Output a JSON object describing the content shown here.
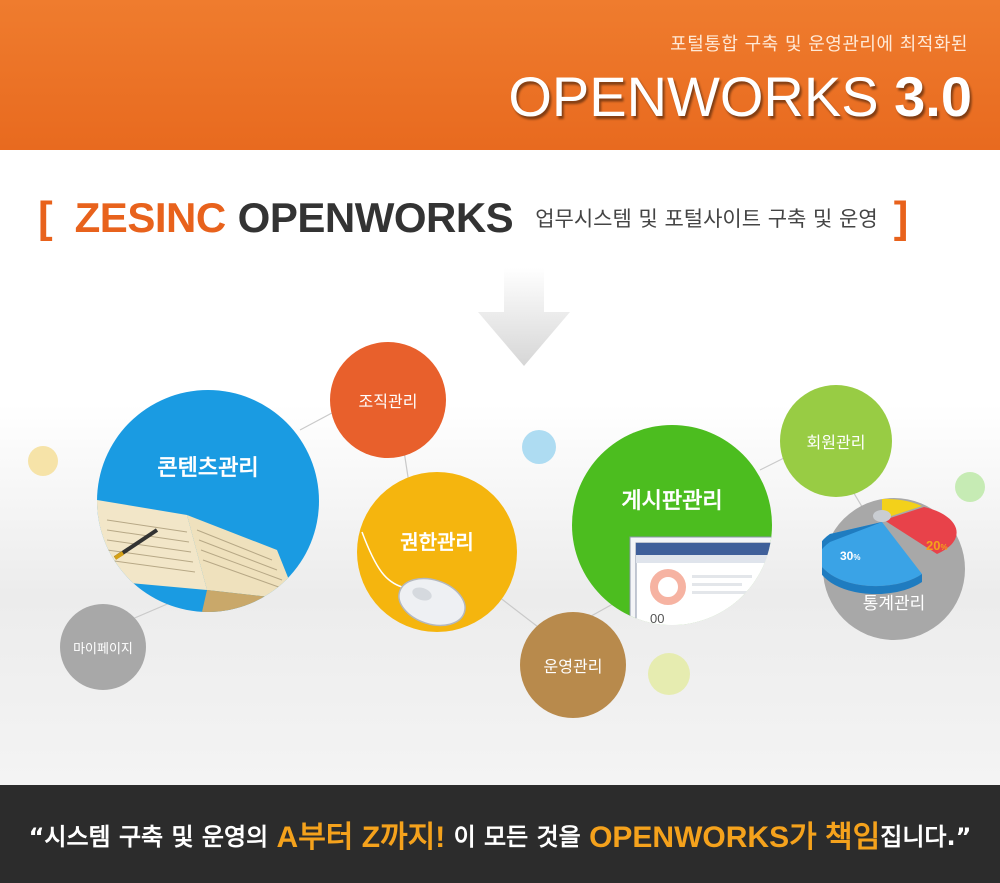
{
  "header": {
    "subtitle": "포털통합 구축 및 운영관리에 최적화된",
    "title_main": "OPENWORKS ",
    "title_version": "3.0"
  },
  "heading": {
    "bracket_open": "[",
    "brand": "ZESINC",
    "product": "OPENWORKS",
    "description": "업무시스템 및 포털사이트 구축 및 운영",
    "bracket_close": "]"
  },
  "modules": {
    "contents": "콘텐츠관리",
    "organization": "조직관리",
    "permission": "권한관리",
    "board": "게시판관리",
    "member": "회원관리",
    "statistics": "통계관리",
    "operation": "운영관리",
    "mypage": "마이페이지",
    "stat_30": "30",
    "stat_20": "20",
    "stat_unit": "%"
  },
  "colors": {
    "header_orange": "#e8701f",
    "contents_blue": "#1a9be2",
    "organization_orange": "#e8602c",
    "permission_yellow": "#f5b50e",
    "board_green": "#4cbd1f",
    "member_lightgreen": "#98cc44",
    "statistics_gray": "#a8a8a8",
    "operation_brown": "#b88a4c",
    "mypage_gray": "#a8a8a8",
    "footer_dark": "#2c2c2c",
    "footer_highlight": "#f5a21c"
  },
  "footer": {
    "open_quote": "“시스템 구축 및 운영의 ",
    "highlight1": "A부터 Z까지!",
    "middle": " 이 모든 것을 ",
    "highlight2": "OPENWORKS가 책임",
    "end": "집니다.”"
  }
}
